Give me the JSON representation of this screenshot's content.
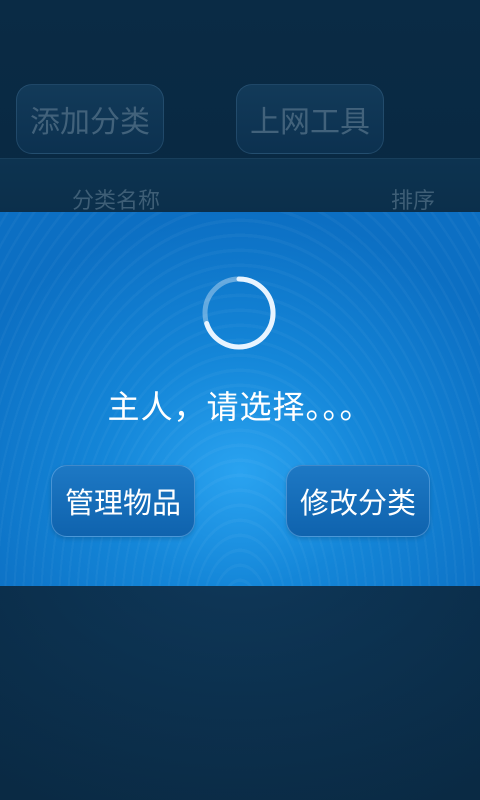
{
  "top_buttons": {
    "add_category": "添加分类",
    "net_tools": "上网工具"
  },
  "list_header": {
    "name_column": "分类名称",
    "order_column": "排序"
  },
  "dialog": {
    "message": "主人，请选择。。。",
    "manage_items": "管理物品",
    "edit_category": "修改分类",
    "spinner_icon": "loading-spinner-icon"
  },
  "colors": {
    "background": "#0a2b45",
    "dialog_blue": "#1486d8",
    "text_white": "#ffffff"
  }
}
